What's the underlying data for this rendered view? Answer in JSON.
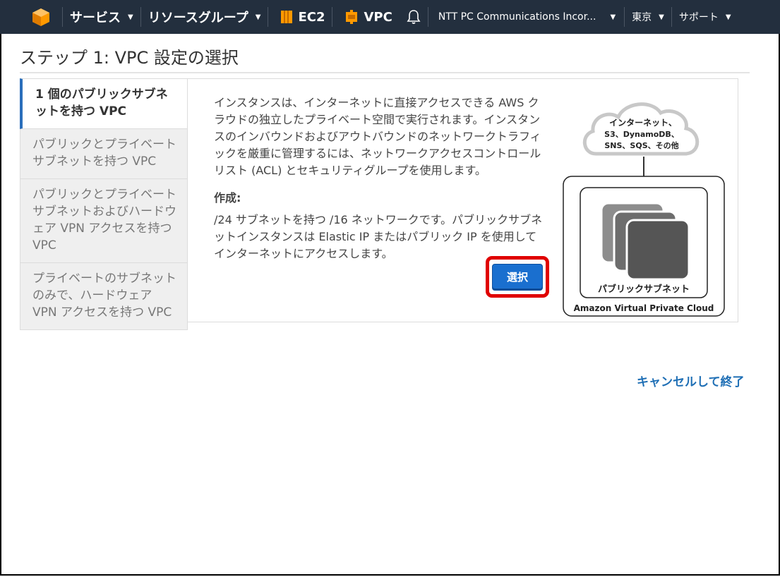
{
  "nav": {
    "logo_icon": "aws-cube-icon",
    "services": "サービス",
    "resource_groups": "リソースグループ",
    "ec2": "EC2",
    "vpc": "VPC",
    "bell_icon": "bell-icon",
    "account": "NTT PC Communications Incor...",
    "region": "東京",
    "support": "サポート",
    "bg_color": "#232f3e",
    "accent_color": "#ff9900"
  },
  "page": {
    "title": "ステップ 1: VPC 設定の選択"
  },
  "tabs": [
    {
      "label": "1 個のパブリックサブネットを持つ VPC",
      "active": true
    },
    {
      "label": "パブリックとプライベートサブネットを持つ VPC",
      "active": false
    },
    {
      "label": "パブリックとプライベートサブネットおよびハードウェア VPN アクセスを持つ VPC",
      "active": false
    },
    {
      "label": "プライベートのサブネットのみで、ハードウェア VPN アクセスを持つ VPC",
      "active": false
    }
  ],
  "panel": {
    "description": "インスタンスは、インターネットに直接アクセスできる AWS クラウドの独立したプライベート空間で実行されます。インスタンスのインバウンドおよびアウトバウンドのネットワークトラフィックを厳重に管理するには、ネットワークアクセスコントロールリスト (ACL) とセキュリティグループを使用します。",
    "creates_label": "作成:",
    "creates_text": "/24 サブネットを持つ /16 ネットワークです。パブリックサブネットインスタンスは Elastic IP またはパブリック IP を使用してインターネットにアクセスします。",
    "select_button": "選択",
    "select_color": "#1a6fcf",
    "highlight_color": "#e00000"
  },
  "diagram": {
    "cloud_line1": "インターネット、",
    "cloud_line2": "S3、DynamoDB、",
    "cloud_line3": "SNS、SQS、その他",
    "subnet_label": "パブリックサブネット",
    "vpc_label": "Amazon Virtual Private Cloud"
  },
  "footer": {
    "cancel": "キャンセルして終了",
    "link_color": "#1f6fb5"
  }
}
